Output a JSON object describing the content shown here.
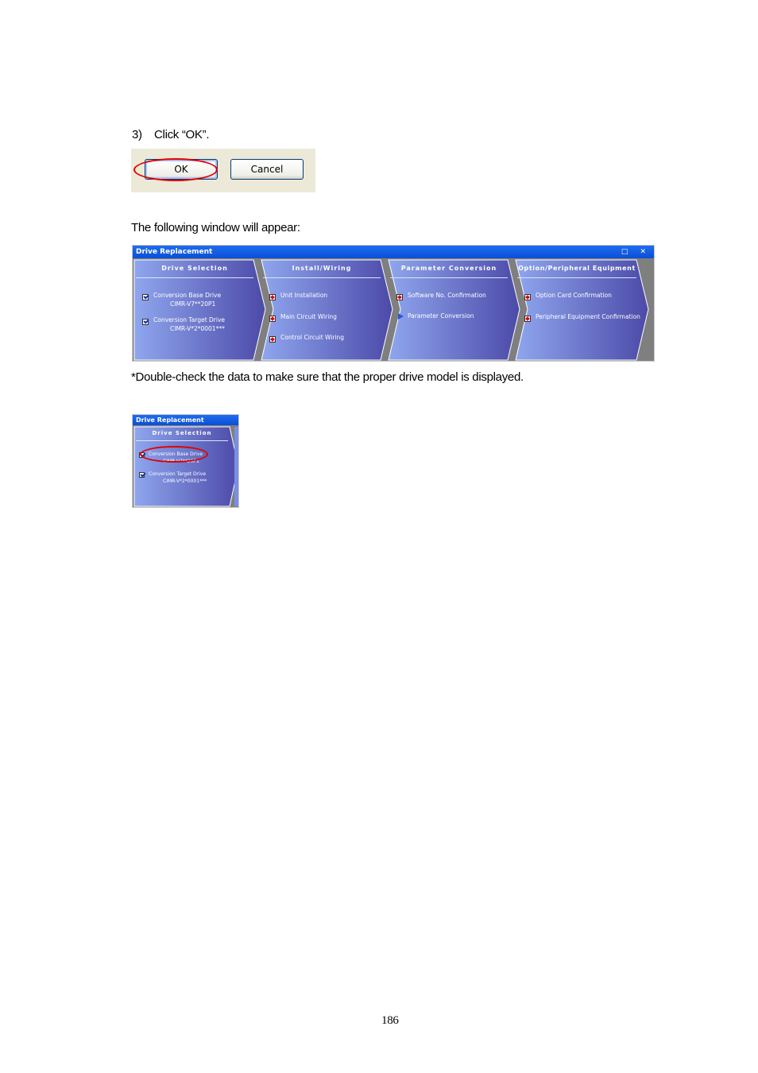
{
  "step": {
    "number": "3)",
    "text": "Click “OK”."
  },
  "dialog": {
    "ok_label": "OK",
    "cancel_label": "Cancel"
  },
  "following_text": "The following window will appear:",
  "window": {
    "title": "Drive Replacement",
    "title_icons": "□ ✕",
    "panels": [
      {
        "title": "Drive Selection",
        "items": [
          {
            "label": "Conversion Base Drive",
            "sub": "CIMR-V7**20P1",
            "icon": "check-icon"
          },
          {
            "label": "Conversion Target Drive",
            "sub": "CIMR-V*2*0001***",
            "icon": "check-icon"
          }
        ]
      },
      {
        "title": "Install/Wiring",
        "items": [
          {
            "label": "Unit Installation",
            "icon": "pending-icon"
          },
          {
            "label": "Main Circuit Wiring",
            "icon": "pending-icon"
          },
          {
            "label": "Control Circuit Wiring",
            "icon": "pending-icon"
          }
        ]
      },
      {
        "title": "Parameter Conversion",
        "items": [
          {
            "label": "Software No. Confirmation",
            "icon": "pending-icon"
          },
          {
            "label": "Parameter Conversion",
            "icon": "arrow-icon"
          }
        ]
      },
      {
        "title": "Option/Peripheral Equipment",
        "items": [
          {
            "label": "Option Card Confirmation",
            "icon": "pending-icon"
          },
          {
            "label": "Peripheral Equipment Confirmation",
            "icon": "pending-icon"
          }
        ]
      }
    ]
  },
  "note": "*Double-check the data to make sure that the proper drive model is displayed.",
  "page_number": "186",
  "colors": {
    "highlight_ring": "#e00000",
    "titlebar": "#0a4fd6",
    "panel_dark": "#4c4aa8",
    "panel_light": "#8fa6ee"
  }
}
